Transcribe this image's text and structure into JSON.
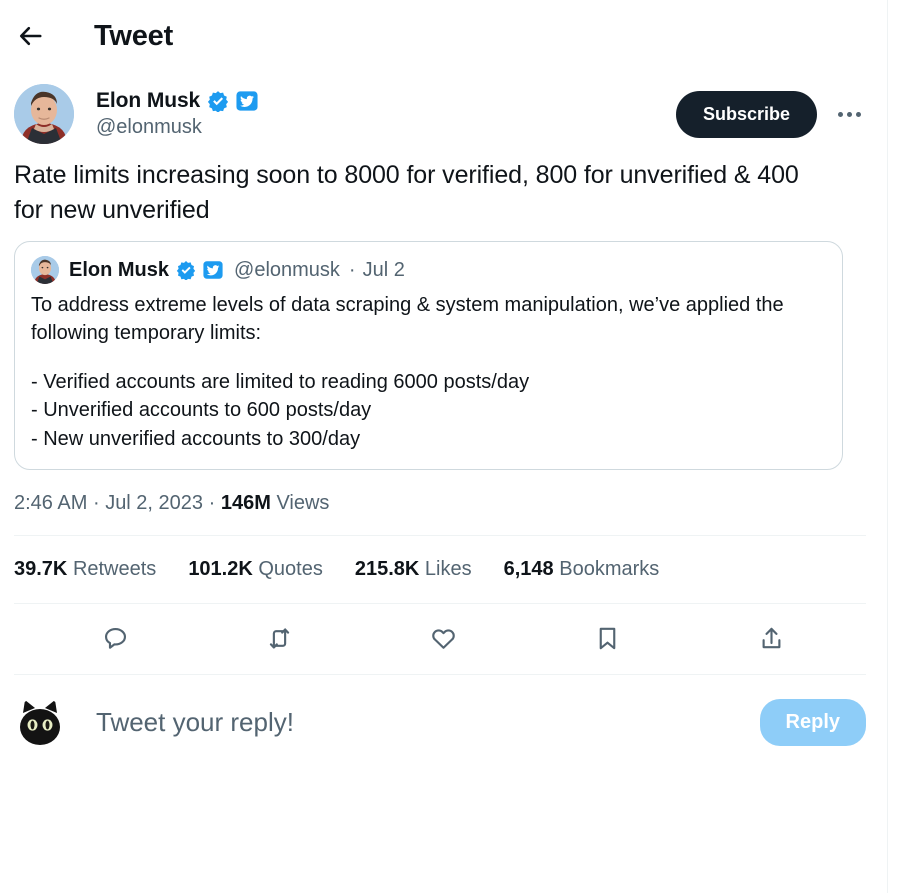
{
  "header": {
    "back_icon": "back-arrow-icon",
    "title": "Tweet"
  },
  "author": {
    "avatar_icon": "elon-musk-avatar",
    "name": "Elon Musk",
    "handle": "@elonmusk",
    "verified_badge_icon": "verified-check-icon",
    "twitter_badge_icon": "twitter-bird-badge-icon",
    "subscribe_label": "Subscribe",
    "more_icon": "more-options-icon"
  },
  "tweet": {
    "text": "Rate limits increasing soon to 8000 for verified, 800 for unverified & 400 for new unverified"
  },
  "quoted_tweet": {
    "avatar_icon": "elon-musk-avatar-small",
    "name": "Elon Musk",
    "handle": "@elonmusk",
    "separator": "·",
    "date": "Jul 2",
    "verified_badge_icon": "verified-check-icon",
    "twitter_badge_icon": "twitter-bird-badge-icon",
    "paragraph": "To address extreme levels of data scraping & system manipulation, we’ve applied the following temporary limits:",
    "bullets": [
      "- Verified accounts are limited to reading 6000 posts/day",
      "- Unverified accounts to 600 posts/day",
      "- New unverified accounts to 300/day"
    ]
  },
  "meta": {
    "time": "2:46 AM",
    "dot1": "·",
    "date": "Jul 2, 2023",
    "dot2": "·",
    "views_count": "146M",
    "views_label": "Views"
  },
  "stats": [
    {
      "count": "39.7K",
      "label": "Retweets"
    },
    {
      "count": "101.2K",
      "label": "Quotes"
    },
    {
      "count": "215.8K",
      "label": "Likes"
    },
    {
      "count": "6,148",
      "label": "Bookmarks"
    }
  ],
  "actions": [
    {
      "icon": "reply-icon"
    },
    {
      "icon": "retweet-icon"
    },
    {
      "icon": "like-heart-icon"
    },
    {
      "icon": "bookmark-icon"
    },
    {
      "icon": "share-icon"
    }
  ],
  "reply": {
    "avatar_icon": "cat-avatar",
    "placeholder": "Tweet your reply!",
    "button_label": "Reply"
  },
  "colors": {
    "text_primary": "#0f1419",
    "text_secondary": "#536471",
    "accent_blue": "#1d9bf0",
    "reply_button": "#8ecdf8",
    "subscribe_button": "#15202b",
    "divider": "#eff3f4",
    "card_border": "#cfd9de"
  }
}
